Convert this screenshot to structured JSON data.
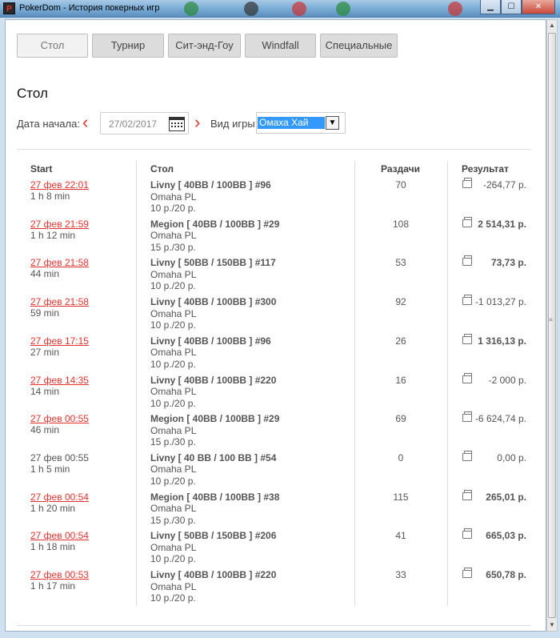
{
  "window": {
    "title": "PokerDom - История покерных игр",
    "icon_text": "P"
  },
  "tabs": [
    {
      "label": "Стол",
      "active": true
    },
    {
      "label": "Турнир",
      "active": false
    },
    {
      "label": "Сит-энд-Гоу",
      "active": false
    },
    {
      "label": "Windfall",
      "active": false
    },
    {
      "label": "Специальные",
      "active": false
    }
  ],
  "section_title": "Стол",
  "filter": {
    "start_label": "Дата начала:",
    "prev_arrow": "‹",
    "date_value": "27/02/2017",
    "next_arrow": "›",
    "game_label": "Вид игры:",
    "game_value": "Омаха Хай"
  },
  "table": {
    "headers": {
      "start": "Start",
      "table": "Стол",
      "hands": "Раздачи",
      "result": "Результат"
    },
    "rows": [
      {
        "date": "27 фев 22:01",
        "linked": true,
        "duration": "1 h 8 min",
        "name": "Livny [ 40BB / 100BB ] #96",
        "game": "Omaha PL",
        "stakes": "10 р./20 р.",
        "hands": "70",
        "result": "-264,77 р.",
        "positive": false
      },
      {
        "date": "27 фев 21:59",
        "linked": true,
        "duration": "1 h 12 min",
        "name": "Megion [ 40BB / 100BB ] #29",
        "game": "Omaha PL",
        "stakes": "15 р./30 р.",
        "hands": "108",
        "result": "2 514,31 р.",
        "positive": true
      },
      {
        "date": "27 фев 21:58",
        "linked": true,
        "duration": "44 min",
        "name": "Livny [ 50BB / 150BB ] #117",
        "game": "Omaha PL",
        "stakes": "10 р./20 р.",
        "hands": "53",
        "result": "73,73 р.",
        "positive": true
      },
      {
        "date": "27 фев 21:58",
        "linked": true,
        "duration": "59 min",
        "name": "Livny [ 40BB / 100BB ] #300",
        "game": "Omaha PL",
        "stakes": "10 р./20 р.",
        "hands": "92",
        "result": "-1 013,27 р.",
        "positive": false
      },
      {
        "date": "27 фев 17:15",
        "linked": true,
        "duration": "27 min",
        "name": "Livny [ 40BB / 100BB ] #96",
        "game": "Omaha PL",
        "stakes": "10 р./20 р.",
        "hands": "26",
        "result": "1 316,13 р.",
        "positive": true
      },
      {
        "date": "27 фев 14:35",
        "linked": true,
        "duration": "14 min",
        "name": "Livny [ 40BB / 100BB ] #220",
        "game": "Omaha PL",
        "stakes": "10 р./20 р.",
        "hands": "16",
        "result": "-2 000 р.",
        "positive": false
      },
      {
        "date": "27 фев 00:55",
        "linked": true,
        "duration": "46 min",
        "name": "Megion [ 40BB / 100BB ] #29",
        "game": "Omaha PL",
        "stakes": "15 р./30 р.",
        "hands": "69",
        "result": "-6 624,74 р.",
        "positive": false
      },
      {
        "date": "27 фев 00:55",
        "linked": false,
        "duration": "1 h 5 min",
        "name": "Livny [ 40 BB / 100 BB ] #54",
        "game": "Omaha PL",
        "stakes": "10 р./20 р.",
        "hands": "0",
        "result": "0,00 р.",
        "positive": false
      },
      {
        "date": "27 фев 00:54",
        "linked": true,
        "duration": "1 h 20 min",
        "name": "Megion [ 40BB / 100BB ] #38",
        "game": "Omaha PL",
        "stakes": "15 р./30 р.",
        "hands": "115",
        "result": "265,01 р.",
        "positive": true
      },
      {
        "date": "27 фев 00:54",
        "linked": true,
        "duration": "1 h 18 min",
        "name": "Livny [ 50BB / 150BB ] #206",
        "game": "Omaha PL",
        "stakes": "10 р./20 р.",
        "hands": "41",
        "result": "665,03 р.",
        "positive": true
      },
      {
        "date": "27 фев 00:53",
        "linked": true,
        "duration": "1 h 17 min",
        "name": "Livny [ 40BB / 100BB ] #220",
        "game": "Omaha PL",
        "stakes": "10 р./20 р.",
        "hands": "33",
        "result": "650,78 р.",
        "positive": true
      }
    ]
  },
  "colors": {
    "accent": "#e3322f",
    "selection": "#3399ff"
  }
}
